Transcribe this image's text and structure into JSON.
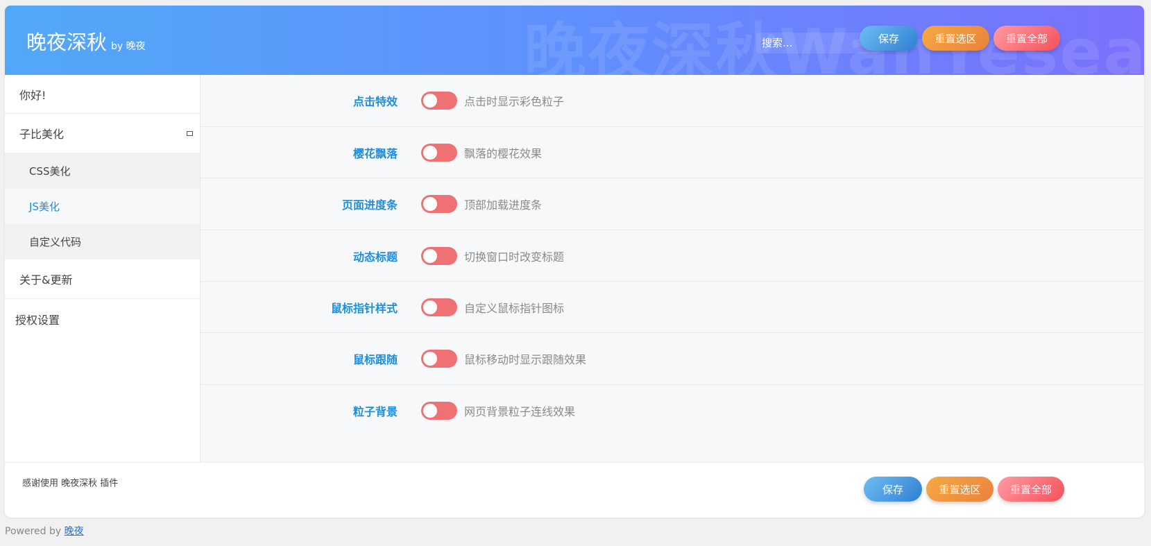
{
  "header": {
    "title": "晚夜深秋",
    "by": "by 晚夜",
    "watermark": "晚夜深秋WanYesea",
    "search_placeholder": "搜索...",
    "save": "保存",
    "reset_section": "重置选区",
    "reset_all": "重置全部"
  },
  "sidebar": {
    "items": [
      {
        "label": "你好!"
      },
      {
        "label": "子比美化"
      },
      {
        "label": "CSS美化"
      },
      {
        "label": "JS美化",
        "active": true
      },
      {
        "label": "自定义代码"
      },
      {
        "label": "关于&更新"
      },
      {
        "label": "授权设置"
      }
    ]
  },
  "settings": [
    {
      "label": "点击特效",
      "desc": "点击时显示彩色粒子",
      "enabled": false
    },
    {
      "label": "樱花飘落",
      "desc": "飘落的樱花效果",
      "enabled": false
    },
    {
      "label": "页面进度条",
      "desc": "顶部加载进度条",
      "enabled": false
    },
    {
      "label": "动态标题",
      "desc": "切换窗口时改变标题",
      "enabled": false
    },
    {
      "label": "鼠标指针样式",
      "desc": "自定义鼠标指针图标",
      "enabled": false
    },
    {
      "label": "鼠标跟随",
      "desc": "鼠标移动时显示跟随效果",
      "enabled": false
    },
    {
      "label": "粒子背景",
      "desc": "网页背景粒子连线效果",
      "enabled": false
    }
  ],
  "footer": {
    "thanks": "感谢使用 晚夜深秋 插件",
    "save": "保存",
    "reset_section": "重置选区",
    "reset_all": "重置全部"
  },
  "powered": {
    "prefix": "Powered by",
    "link": "晚夜"
  },
  "colors": {
    "header_gradient_start": "#52a8f8",
    "header_gradient_end": "#7a71fc",
    "label_blue": "#1e8ede",
    "toggle_off": "#f07173"
  }
}
